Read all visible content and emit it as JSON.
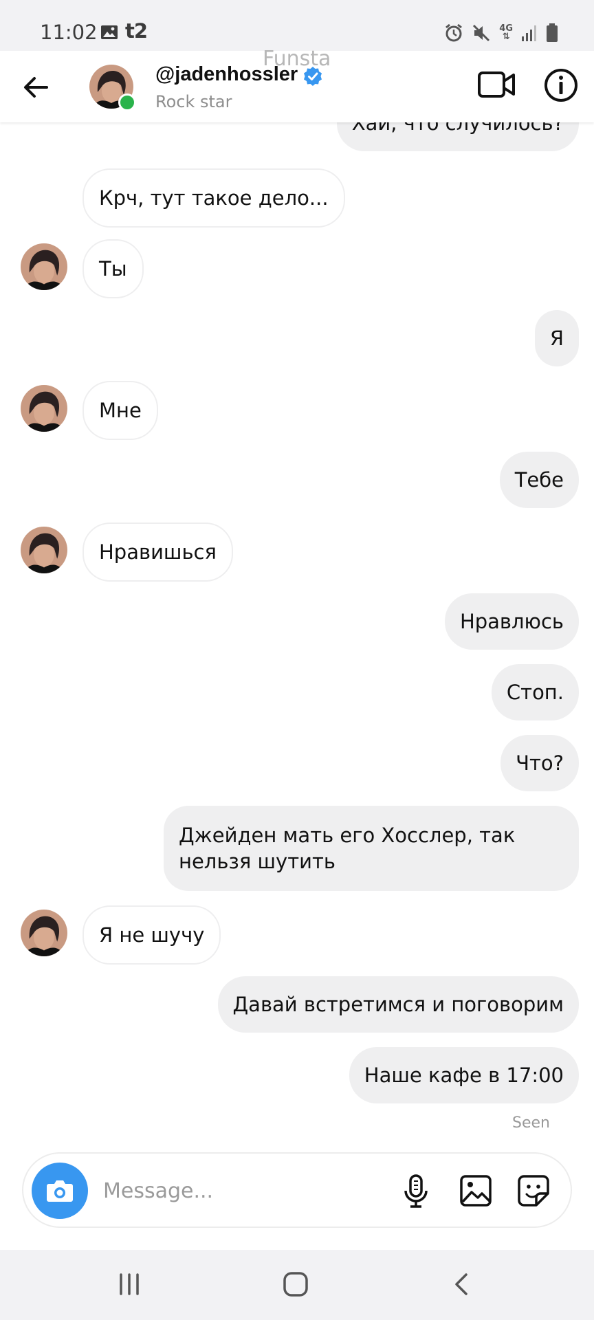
{
  "status_bar": {
    "time": "11:02",
    "carrier": "t2",
    "network": "4G",
    "icons": [
      "gallery-icon",
      "alarm-icon",
      "mute-icon",
      "signal-icon",
      "battery-icon"
    ]
  },
  "header": {
    "username": "@jadenhossler",
    "status": "Rock star",
    "verified": true,
    "online": true,
    "watermark": "Funsta",
    "icons": [
      "back-arrow-icon",
      "video-call-icon",
      "info-icon"
    ]
  },
  "messages": [
    {
      "dir": "out",
      "text": "Хаи, что случилось?"
    },
    {
      "dir": "in",
      "text": "Крч, тут такое дело..."
    },
    {
      "dir": "in",
      "text": "Ты"
    },
    {
      "dir": "out",
      "text": "Я"
    },
    {
      "dir": "in",
      "text": "Мне"
    },
    {
      "dir": "out",
      "text": "Тебе"
    },
    {
      "dir": "in",
      "text": "Нравишься"
    },
    {
      "dir": "out",
      "text": "Нравлюсь"
    },
    {
      "dir": "out",
      "text": "Стоп."
    },
    {
      "dir": "out",
      "text": "Что?"
    },
    {
      "dir": "out",
      "text": "Джейден мать его Хосслер, так нельзя шутить"
    },
    {
      "dir": "in",
      "text": "Я не шучу"
    },
    {
      "dir": "out",
      "text": "Давай встретимся и поговорим"
    },
    {
      "dir": "out",
      "text": "Наше кафе в 17:00"
    }
  ],
  "seen_label": "Seen",
  "composer": {
    "placeholder": "Message...",
    "value": "",
    "icons": [
      "camera-icon",
      "microphone-icon",
      "gallery-icon",
      "sticker-icon"
    ]
  },
  "nav_bar": {
    "icons": [
      "recent-apps-icon",
      "home-icon",
      "back-icon"
    ]
  },
  "colors": {
    "accent": "#3897f0",
    "online": "#2ab34b",
    "outgoing_bubble": "#efeff0",
    "incoming_border": "#eeeeef"
  }
}
